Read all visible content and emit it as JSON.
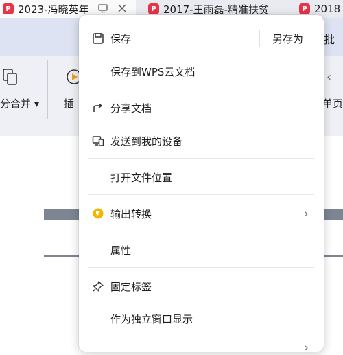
{
  "tabs": [
    {
      "title": "2023-冯晓英年"
    },
    {
      "title": "2017-王雨磊-精准扶贫"
    },
    {
      "title": "2018"
    }
  ],
  "toolbar": {
    "merge_label": "分合并",
    "insert_label": "插",
    "page_label": "单页",
    "batch_label": "批"
  },
  "menu": {
    "save": "保存",
    "save_as": "另存为",
    "save_cloud": "保存到WPS云文档",
    "share": "分享文档",
    "send_device": "发送到我的设备",
    "open_location": "打开文件位置",
    "export_convert": "输出转换",
    "properties": "属性",
    "pin_tab": "固定标签",
    "standalone_window": "作为独立窗口显示"
  },
  "colors": {
    "pdf_red": "#e8344a",
    "convert_yellow": "#f5b400"
  }
}
